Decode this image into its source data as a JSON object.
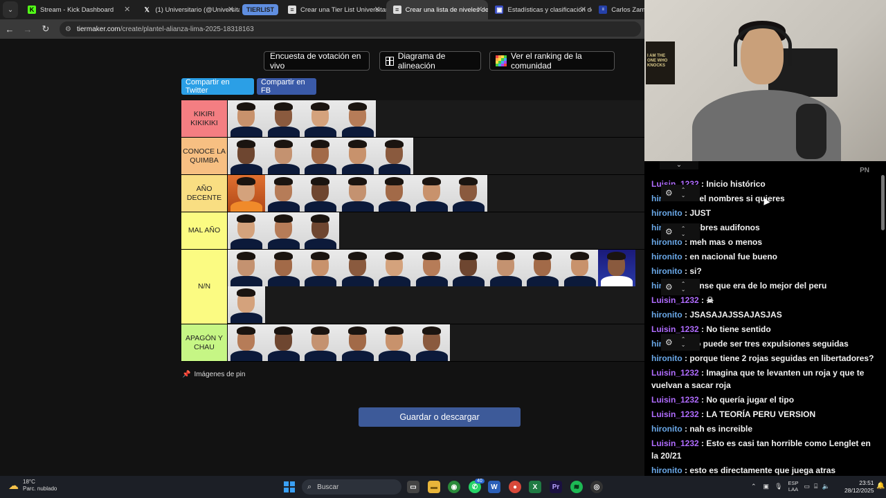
{
  "browser": {
    "tabs": [
      {
        "title": "Stream - Kick Dashboard",
        "icon": "kick-icon",
        "active": false
      },
      {
        "title": "(1) Universitario (@Universitario",
        "icon": "x-icon",
        "active": false
      },
      {
        "group": "TIERLIST"
      },
      {
        "title": "Crear una Tier List Universitario",
        "icon": "tiermaker-icon",
        "active": false
      },
      {
        "title": "Crear una lista de niveles de Al",
        "icon": "tiermaker-icon",
        "active": true
      },
      {
        "title": "Estadísticas y clasificación de C",
        "icon": "stats-icon",
        "active": false
      },
      {
        "title": "Carlos Zamb",
        "icon": "site-icon",
        "active": false
      }
    ],
    "url_host": "tiermaker.com",
    "url_path": "/create/plantel-alianza-lima-2025-18318163"
  },
  "page": {
    "top_buttons": {
      "live_poll": "Encuesta de votación en vivo",
      "alignment": "Diagrama de alineación",
      "community": "Ver el ranking de la comunidad"
    },
    "share": {
      "twitter": "Compartir en Twitter",
      "fb": "Compartir en FB"
    },
    "tiers": [
      {
        "label": "KIKIRI KIKIKIKI",
        "color": "#f47e82",
        "count": 4
      },
      {
        "label": "CONOCE LA QUIMBA",
        "color": "#f7bf82",
        "count": 5
      },
      {
        "label": "AÑO DECENTE",
        "color": "#f9de82",
        "count": 7
      },
      {
        "label": "MAL AÑO",
        "color": "#fbfb82",
        "count": 3
      },
      {
        "label": "N/N",
        "color": "#fbfb82",
        "count": 12
      },
      {
        "label": "APAGÓN Y CHAU",
        "color": "#c6f685",
        "count": 6
      }
    ],
    "pin_label": "Imágenes de pin",
    "save_label": "Guardar o descargar"
  },
  "chat": {
    "pn": "PN",
    "messages": [
      {
        "user": "Luisin_1232",
        "text": "Inicio histórico"
      },
      {
        "user": "hironito",
        "text": "di el nombres si quieres"
      },
      {
        "user": "hironito",
        "text": "JUST"
      },
      {
        "user": "hironito",
        "text": "Pobres audifonos"
      },
      {
        "user": "hironito",
        "text": "meh mas o menos"
      },
      {
        "user": "hironito",
        "text": "en nacional fue bueno"
      },
      {
        "user": "hironito",
        "text": "si?"
      },
      {
        "user": "hironito",
        "text": "pense que era de lo mejor del peru"
      },
      {
        "user": "Luisin_1232",
        "text": "☠"
      },
      {
        "user": "hironito",
        "text": "JSASAJAJSSAJASJAS"
      },
      {
        "user": "Luisin_1232",
        "text": "No tiene sentido"
      },
      {
        "user": "hironito",
        "text": "No puede ser tres expulsiones seguidas"
      },
      {
        "user": "hironito",
        "text": "porque tiene 2 rojas seguidas en libertadores?"
      },
      {
        "user": "Luisin_1232",
        "text": "Imagina que te levanten un roja y que te vuelvan a sacar roja"
      },
      {
        "user": "Luisin_1232",
        "text": "No quería jugar el tipo"
      },
      {
        "user": "Luisin_1232",
        "text": "LA TEORÍA PERU VERSION"
      },
      {
        "user": "hironito",
        "text": "nah es increible"
      },
      {
        "user": "Luisin_1232",
        "text": "Esto es casi tan horrible como Lenglet en la 20/21"
      },
      {
        "user": "hironito",
        "text": "esto es directamente que juega atras"
      }
    ]
  },
  "webcam": {
    "poster_text": "I AM THE ONE WHO KNOCKS"
  },
  "taskbar": {
    "weather_temp": "18°C",
    "weather_desc": "Parc. nublado",
    "search_placeholder": "Buscar",
    "lang_top": "ESP",
    "lang_bottom": "LAA",
    "time": "23:51",
    "date": "28/12/2025",
    "whatsapp_badge": "40"
  }
}
